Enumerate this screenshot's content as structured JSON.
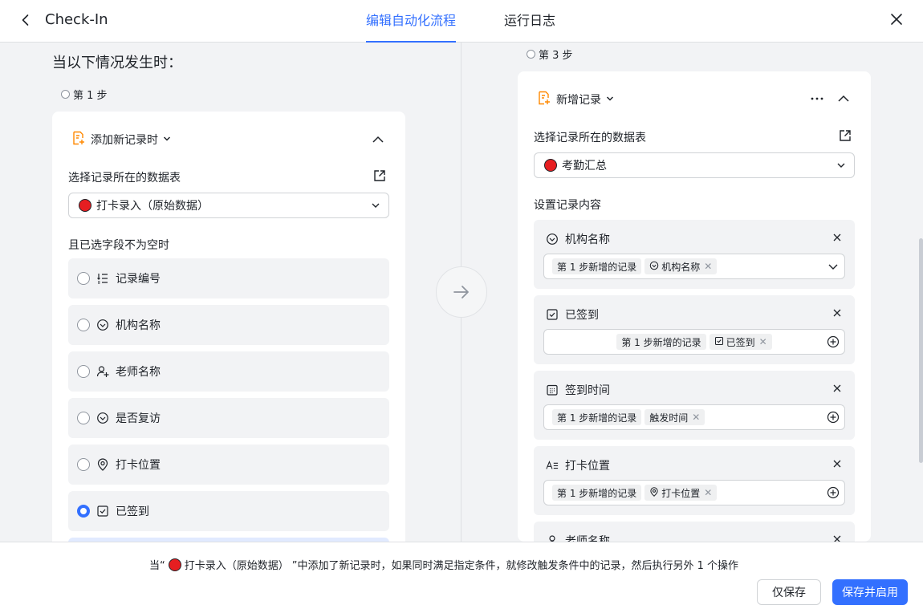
{
  "header": {
    "title": "Check-In",
    "tabs": [
      {
        "label": "编辑自动化流程",
        "active": true
      },
      {
        "label": "运行日志",
        "active": false
      }
    ]
  },
  "trigger": {
    "when_title": "当以下情况发生时：",
    "step_label": "第 1 步",
    "trigger_type": "添加新记录时",
    "table_label": "选择记录所在的数据表",
    "table_value": "打卡录入（原始数据）",
    "condition_label": "且已选字段不为空时",
    "fields": [
      {
        "icon": "autonumber-icon",
        "label": "记录编号",
        "checked": false
      },
      {
        "icon": "single-select-icon",
        "label": "机构名称",
        "checked": false
      },
      {
        "icon": "person-icon",
        "label": "老师名称",
        "checked": false
      },
      {
        "icon": "single-select-icon",
        "label": "是否复访",
        "checked": false
      },
      {
        "icon": "location-icon",
        "label": "打卡位置",
        "checked": false
      },
      {
        "icon": "checkbox-icon",
        "label": "已签到",
        "checked": true
      }
    ]
  },
  "action": {
    "step_label": "第 3 步",
    "action_type": "新增记录",
    "table_label": "选择记录所在的数据表",
    "table_value": "考勤汇总",
    "content_label": "设置记录内容",
    "fields": [
      {
        "title": "机构名称",
        "icon": "single-select-icon",
        "source": "第 1 步新增的记录",
        "value_icon": "single-select-icon",
        "value": "机构名称"
      },
      {
        "title": "已签到",
        "icon": "checkbox-icon",
        "source": "第 1 步新增的记录",
        "value_icon": "checkbox-icon",
        "value": "已签到"
      },
      {
        "title": "签到时间",
        "icon": "calendar-icon",
        "source": "第 1 步新增的记录",
        "value_icon": "",
        "value": "触发时间"
      },
      {
        "title": "打卡位置",
        "icon": "text-icon",
        "source": "第 1 步新增的记录",
        "value_icon": "location-icon",
        "value": "打卡位置"
      },
      {
        "title": "老师名称",
        "icon": "person-icon"
      }
    ]
  },
  "footer": {
    "summary_prefix": "当“",
    "summary_table": "打卡录入（原始数据）",
    "summary_suffix": "”中添加了新记录时，如果同时满足指定条件，就修改触发条件中的记录，然后执行另外 1 个操作",
    "save_label": "仅保存",
    "save_enable_label": "保存并启用"
  },
  "colors": {
    "accent": "#3370ff",
    "table_dot": "#e61e21",
    "trigger_icon": "#ff8800"
  }
}
